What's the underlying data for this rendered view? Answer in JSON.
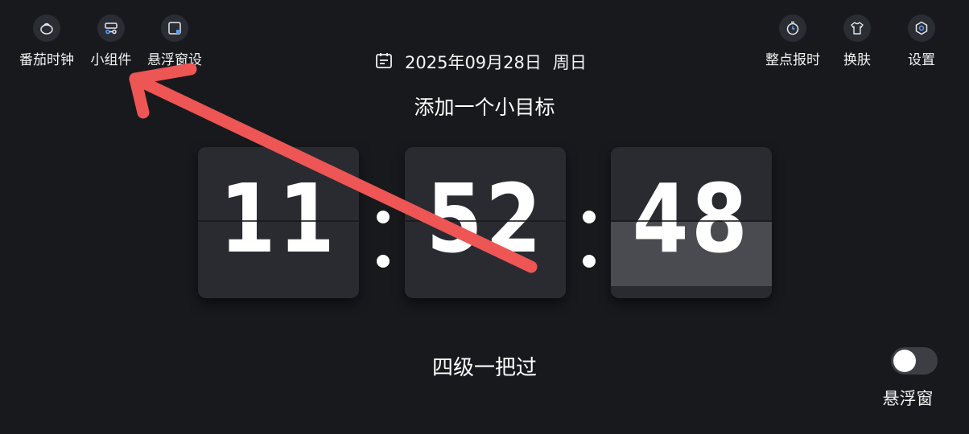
{
  "toolbar_left": [
    {
      "label": "番茄时钟",
      "icon": "tomato-icon"
    },
    {
      "label": "小组件",
      "icon": "widget-icon"
    },
    {
      "label": "悬浮窗设",
      "icon": "floating-window-icon"
    }
  ],
  "toolbar_right": [
    {
      "label": "整点报时",
      "icon": "clock-icon"
    },
    {
      "label": "换肤",
      "icon": "shirt-icon"
    },
    {
      "label": "设置",
      "icon": "hexagon-settings-icon"
    }
  ],
  "date": {
    "icon": "calendar-icon",
    "text": "2025年09月28日",
    "weekday": "周日"
  },
  "goal_text": "添加一个小目标",
  "clock": {
    "hours": "11",
    "minutes": "52",
    "seconds": "48"
  },
  "slogan": "四级一把过",
  "floating_window_toggle": {
    "label": "悬浮窗",
    "enabled": false
  },
  "colors": {
    "background": "#18191d",
    "card": "#2a2b31",
    "annotation_arrow": "#ee5555"
  }
}
